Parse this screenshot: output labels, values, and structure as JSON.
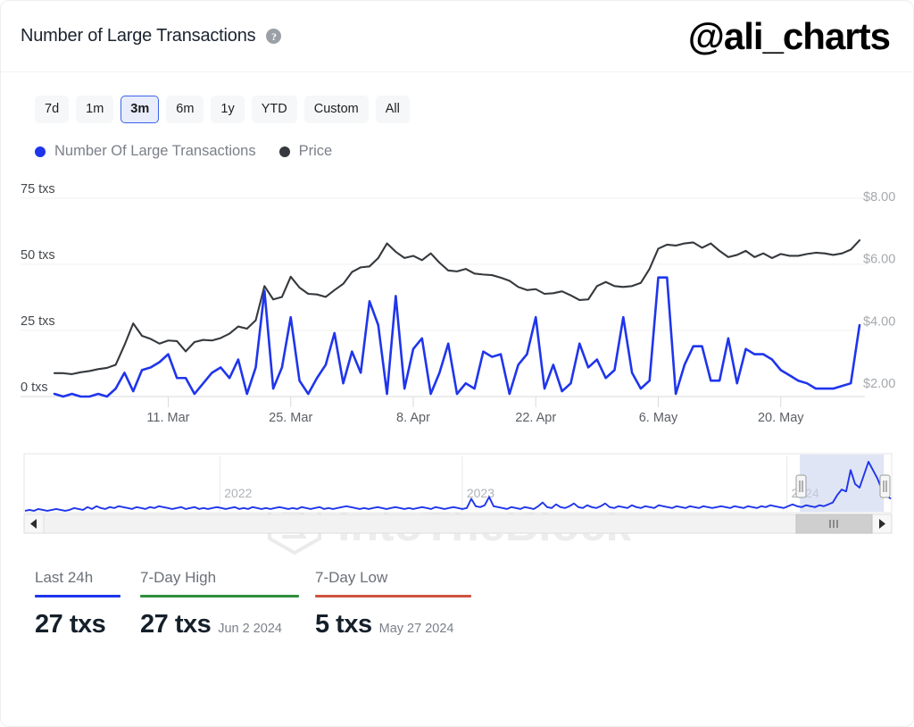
{
  "header": {
    "title": "Number of Large Transactions",
    "help_icon": "question-mark-circle-icon",
    "handle": "@ali_charts"
  },
  "range_selector": {
    "options": [
      "7d",
      "1m",
      "3m",
      "6m",
      "1y",
      "YTD",
      "Custom",
      "All"
    ],
    "selected": "3m"
  },
  "legend": [
    {
      "label": "Number Of Large Transactions",
      "color": "#1f35ec"
    },
    {
      "label": "Price",
      "color": "#35393d"
    }
  ],
  "watermark": "IntoTheBlock",
  "stats": [
    {
      "label": "Last 24h",
      "value": "27 txs",
      "date": "",
      "rule_color": "#1f35ec"
    },
    {
      "label": "7-Day High",
      "value": "27 txs",
      "date": "Jun 2 2024",
      "rule_color": "#2f8f3d"
    },
    {
      "label": "7-Day Low",
      "value": "5 txs",
      "date": "May 27 2024",
      "rule_color": "#cf5340"
    }
  ],
  "navigator": {
    "year_labels": [
      "2022",
      "2023",
      "2024"
    ],
    "left_arrow": "scroll-left-arrow-icon",
    "right_arrow": "scroll-right-arrow-icon",
    "left_handle": "range-handle-left",
    "right_handle": "range-handle-right",
    "grip": "scrollbar-grip"
  },
  "chart_data": {
    "type": "line",
    "title": "Number of Large Transactions",
    "xlabel": "",
    "ylabel": "txs",
    "y_left_label": "txs",
    "y_right_label": "USD",
    "ylim": [
      0,
      80
    ],
    "y2lim": [
      1.6,
      8.4
    ],
    "y_ticks": [
      0,
      25,
      50,
      75
    ],
    "y_tick_labels": [
      "0 txs",
      "25 txs",
      "50 txs",
      "75 txs"
    ],
    "y2_ticks": [
      2,
      4,
      6,
      8
    ],
    "y2_tick_labels": [
      "$2.00",
      "$4.00",
      "$6.00",
      "$8.00"
    ],
    "x_tick_labels": [
      "11. Mar",
      "25. Mar",
      "8. Apr",
      "22. Apr",
      "6. May",
      "20. May"
    ],
    "x_tick_positions": [
      13,
      27,
      41,
      55,
      69,
      83
    ],
    "grid": true,
    "legend_position": "top-left",
    "series": [
      {
        "name": "Number Of Large Transactions",
        "color": "#1f35ec",
        "axis": "left",
        "values": [
          1,
          0,
          1,
          0,
          0,
          1,
          0,
          3,
          9,
          2,
          10,
          11,
          13,
          16,
          7,
          7,
          1,
          5,
          9,
          11,
          7,
          14,
          1,
          11,
          40,
          3,
          11,
          30,
          6,
          1,
          7,
          12,
          24,
          5,
          17,
          9,
          36,
          27,
          1,
          38,
          3,
          18,
          22,
          1,
          9,
          20,
          1,
          5,
          3,
          17,
          15,
          16,
          1,
          12,
          16,
          30,
          3,
          12,
          2,
          5,
          20,
          11,
          14,
          7,
          10,
          30,
          9,
          3,
          6,
          45,
          45,
          1,
          12,
          19,
          19,
          6,
          6,
          22,
          5,
          18,
          16,
          16,
          14,
          10,
          8,
          6,
          5,
          3,
          3,
          3,
          4,
          5,
          27
        ]
      },
      {
        "name": "Price",
        "color": "#35393d",
        "axis": "right",
        "values": [
          2.35,
          2.35,
          2.32,
          2.38,
          2.42,
          2.48,
          2.52,
          2.62,
          3.25,
          3.95,
          3.55,
          3.45,
          3.3,
          3.4,
          3.38,
          3.05,
          3.35,
          3.42,
          3.4,
          3.48,
          3.62,
          3.85,
          3.78,
          4.05,
          5.15,
          4.72,
          4.8,
          5.45,
          5.1,
          4.9,
          4.88,
          4.8,
          5.02,
          5.22,
          5.6,
          5.75,
          5.78,
          6.05,
          6.52,
          6.25,
          6.05,
          6.12,
          5.98,
          6.2,
          5.9,
          5.65,
          5.62,
          5.7,
          5.55,
          5.52,
          5.5,
          5.42,
          5.32,
          5.12,
          5.02,
          5.05,
          4.9,
          4.92,
          4.98,
          4.85,
          4.7,
          4.72,
          5.15,
          5.28,
          5.15,
          5.12,
          5.15,
          5.25,
          5.7,
          6.35,
          6.48,
          6.45,
          6.52,
          6.55,
          6.38,
          6.52,
          6.28,
          6.08,
          6.15,
          6.28,
          6.08,
          6.2,
          6.05,
          6.18,
          6.12,
          6.12,
          6.18,
          6.22,
          6.2,
          6.15,
          6.2,
          6.32,
          6.62
        ]
      }
    ],
    "navigator_series": {
      "name": "Number Of Large Transactions",
      "color": "#1f35ec",
      "selected_range": {
        "start_pct": 89.5,
        "end_pct": 99.2
      },
      "values": [
        1,
        2,
        1,
        3,
        2,
        1,
        2,
        3,
        2,
        1,
        2,
        4,
        3,
        2,
        5,
        3,
        6,
        4,
        3,
        5,
        4,
        6,
        5,
        4,
        3,
        5,
        4,
        3,
        5,
        4,
        6,
        5,
        4,
        3,
        4,
        5,
        3,
        4,
        5,
        3,
        4,
        3,
        4,
        5,
        4,
        3,
        4,
        5,
        3,
        4,
        3,
        5,
        4,
        3,
        4,
        3,
        4,
        5,
        4,
        3,
        4,
        3,
        5,
        4,
        3,
        4,
        5,
        3,
        4,
        3,
        4,
        5,
        6,
        5,
        4,
        3,
        4,
        3,
        4,
        5,
        4,
        3,
        4,
        5,
        4,
        3,
        4,
        3,
        4,
        5,
        4,
        3,
        5,
        4,
        3,
        4,
        5,
        4,
        3,
        4,
        14,
        6,
        5,
        7,
        16,
        6,
        5,
        4,
        3,
        5,
        4,
        3,
        5,
        4,
        3,
        6,
        10,
        5,
        4,
        8,
        5,
        4,
        6,
        9,
        5,
        4,
        7,
        5,
        4,
        6,
        9,
        5,
        4,
        6,
        5,
        4,
        7,
        5,
        4,
        6,
        5,
        4,
        7,
        6,
        5,
        4,
        6,
        5,
        4,
        6,
        5,
        4,
        6,
        5,
        4,
        5,
        6,
        5,
        4,
        6,
        5,
        4,
        6,
        5,
        4,
        6,
        5,
        7,
        6,
        5,
        4,
        6,
        8,
        6,
        5,
        7,
        6,
        5,
        7,
        6,
        8,
        10,
        18,
        24,
        22,
        45,
        30,
        26,
        40,
        54,
        45,
        36,
        24,
        18,
        14
      ]
    }
  }
}
